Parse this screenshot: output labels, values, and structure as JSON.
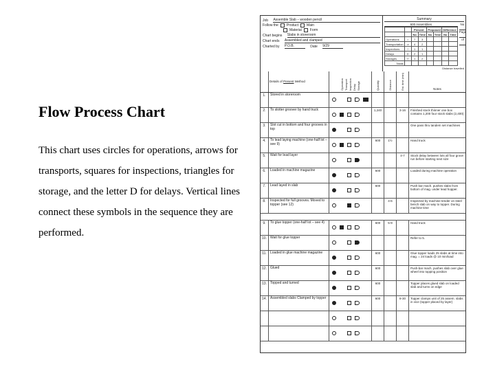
{
  "left": {
    "heading": "Flow Process Chart",
    "body": "This chart uses circles for operations, arrows for transports, squares for inspections, triangles for storage, and the letter D for delays. Vertical lines connect these symbols in the sequence they are performed."
  },
  "header": {
    "job_label": "Job",
    "job_value": "Assemble Slab – wooden pencil",
    "follow_the": "Follow the",
    "product": "Product",
    "main": "Main",
    "material": "Material",
    "form": "Form",
    "chart_begins_label": "Chart begins",
    "chart_begins_value": "Slabs in storeroom",
    "chart_ends_label": "Chart ends",
    "chart_ends_value": "Assembled and clamped",
    "charted_by_label": "Charted by",
    "charted_by_value": "P.O.B.",
    "date_label": "Date",
    "date_value": "9/29",
    "summary_title": "Summary",
    "qty_label": "600 Assemblies",
    "page_label": "Page",
    "no_label": "No.",
    "of_label": "of",
    "distance_travelled": "Distance travelled",
    "summary_rows": [
      {
        "name": "Operations",
        "sym": "○",
        "p_no": "7",
        "p_time": "3"
      },
      {
        "name": "Transportation",
        "sym": "⇒",
        "p_no": "4",
        "p_time": "2"
      },
      {
        "name": "Inspections",
        "sym": "□",
        "p_no": "1",
        "p_time": "1"
      },
      {
        "name": "Delays",
        "sym": "D",
        "p_no": "2",
        "p_time": "1"
      },
      {
        "name": "Storages",
        "sym": "▽",
        "p_no": "1",
        "p_time": "2"
      }
    ],
    "totals_label": "Totals"
  },
  "colhdr": {
    "details": "Details of",
    "present": "Present",
    "proposed": "Proposed",
    "method": "Method",
    "operation": "Operation",
    "transport": "Transport",
    "inspection": "Inspection",
    "delay": "Delay",
    "storage": "Storage",
    "quantity": "Quantity",
    "distance": "Distance",
    "time": "Est. time (min)",
    "notes": "Notes"
  },
  "steps": [
    {
      "no": "1.",
      "desc": "Stored in storeroom",
      "active": 4,
      "qty": "",
      "dist": "",
      "time": "",
      "note": ""
    },
    {
      "no": "2.",
      "desc": "To slotter groover by hand truck",
      "active": 1,
      "qty": "1,240",
      "dist": "",
      "time": "3-16",
      "note": "Finished stock thinner one box contains 1,200 four stock slabs (2,400)"
    },
    {
      "no": "3.",
      "desc": "Slot cut in bottom and four grooves in top",
      "active": 0,
      "qty": "",
      "dist": "",
      "time": "",
      "note": "One pass thru tandem set machines"
    },
    {
      "no": "4.",
      "desc": "To lead laying machine (one-half lot – see 9)",
      "active": 1,
      "qty": "600",
      "dist": "1½",
      "time": "",
      "note": "Hand truck"
    },
    {
      "no": "5.",
      "desc": "Wait for lead layer",
      "active": 3,
      "qty": "",
      "dist": "",
      "time": "4-7",
      "note": "Stock delay between lots all four grove run before starting next size"
    },
    {
      "no": "6.",
      "desc": "Loaded in machine magazine",
      "active": 0,
      "qty": "600",
      "dist": "",
      "time": "",
      "note": "Loaded during machine operation"
    },
    {
      "no": "7.",
      "desc": "Lead layed in slab",
      "active": 0,
      "qty": "600",
      "dist": "",
      "time": "",
      "note": "Push bar mach. pushes slabs from bottom of mag. under lead hopper."
    },
    {
      "no": "8.",
      "desc": "Inspected for full grooves. Moved to topper (see 12)",
      "active": 2,
      "qty": "",
      "dist": "4-6",
      "time": "",
      "note": "Inspected by machine tender on steel bench slab on way to topper. During machine time"
    }
  ],
  "steps2": [
    {
      "no": "9.",
      "desc": "To glue topper (one-half lot – see 4)",
      "active": 1,
      "qty": "600",
      "dist": "5-9",
      "time": "",
      "note": "Hand truck"
    },
    {
      "no": "10.",
      "desc": "Wait for glue topper",
      "active": 3,
      "qty": "",
      "dist": "",
      "time": "",
      "note": "Refer to 5."
    },
    {
      "no": "11.",
      "desc": "Loaded in glue machine magazine",
      "active": 0,
      "qty": "600",
      "dist": "",
      "time": "",
      "note": "Glue topper loads 25 slabs at time into mag. = 24 loads @ 10 min/load"
    },
    {
      "no": "12.",
      "desc": "Glued",
      "active": 0,
      "qty": "600",
      "dist": "",
      "time": "",
      "note": "Push-bar mach. pushes slab over glue wheel into topping position"
    },
    {
      "no": "13.",
      "desc": "Topped and turned",
      "active": 0,
      "qty": "600",
      "dist": "",
      "time": "",
      "note": "Topper places glued slab on loaded slab and turns on edge"
    },
    {
      "no": "14.",
      "desc": "Assembled slabs Clamped by topper",
      "active": 0,
      "qty": "600",
      "dist": "",
      "time": "8-30",
      "note": "Topper clamps unit of 25 assem. slabs in vice (topper placed by layer)"
    }
  ],
  "blank_rows": 2
}
